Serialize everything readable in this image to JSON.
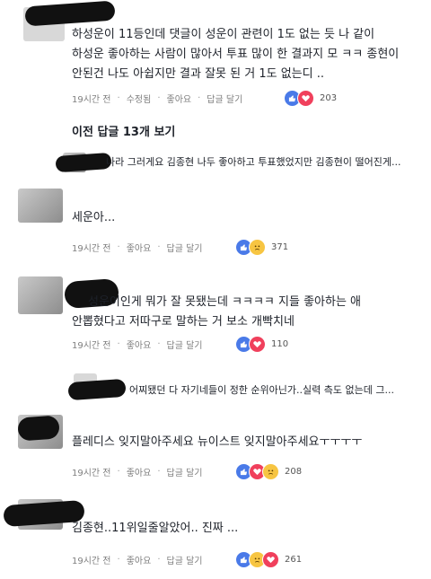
{
  "comments": [
    {
      "text_lines": [
        "하성운이 11등인데 댓글이 성운이 관련이 1도 없는 듯 나 같이",
        "하성운 좋아하는 사람이 많아서 투표 많이 한 결과지 모 ㅋㅋ 종현이",
        "안된건 나도 아쉽지만 결과 잘못 된 거 1도 없는디 .."
      ],
      "time": "19시간 전",
      "edited": "수정됨",
      "like": "좋아요",
      "reply": "답글 달기",
      "reactions": [
        "like",
        "love"
      ],
      "count": "203"
    },
    {
      "text_lines": [
        "나라 그러게요 김종현 나두 좋아하고 투표했었지만 김종현이 떨어진게..."
      ]
    },
    {
      "text_lines": [
        "세운아..."
      ],
      "time": "19시간 전",
      "like": "좋아요",
      "reply": "답글 달기",
      "reactions": [
        "like",
        "sad"
      ],
      "count": "371"
    },
    {
      "text_lines": [
        "성운이인게 뭐가 잘 못됐는데 ㅋㅋㅋㅋ 지들 좋아하는 애",
        "안뽑혔다고 저따구로 말하는 거 보소  개빡치네"
      ],
      "time": "19시간 전",
      "like": "좋아요",
      "reply": "답글 달기",
      "reactions": [
        "like",
        "love"
      ],
      "count": "110"
    },
    {
      "text_lines": [
        "어찌됐던 다 자기네들이 정한 순위아닌가..실력 측도 없는데 그..."
      ]
    },
    {
      "text_lines": [
        "플레디스 잊지말아주세요 뉴이스트 잊지말아주세요ㅜㅜㅜㅜ"
      ],
      "time": "19시간 전",
      "like": "좋아요",
      "reply": "답글 달기",
      "reactions": [
        "like",
        "love",
        "sad"
      ],
      "count": "208"
    },
    {
      "text_lines": [
        "김종현..11위일줄알았어.. 진짜 ..."
      ],
      "time": "19시간 전",
      "like": "좋아요",
      "reply": "답글 달기",
      "reactions": [
        "like",
        "sad",
        "love"
      ],
      "count": "261"
    }
  ],
  "previous_replies": "이전 답글 13개 보기",
  "colors": {
    "like": "#4a7ae8",
    "love": "#f0405c",
    "sad": "#f7c542"
  }
}
